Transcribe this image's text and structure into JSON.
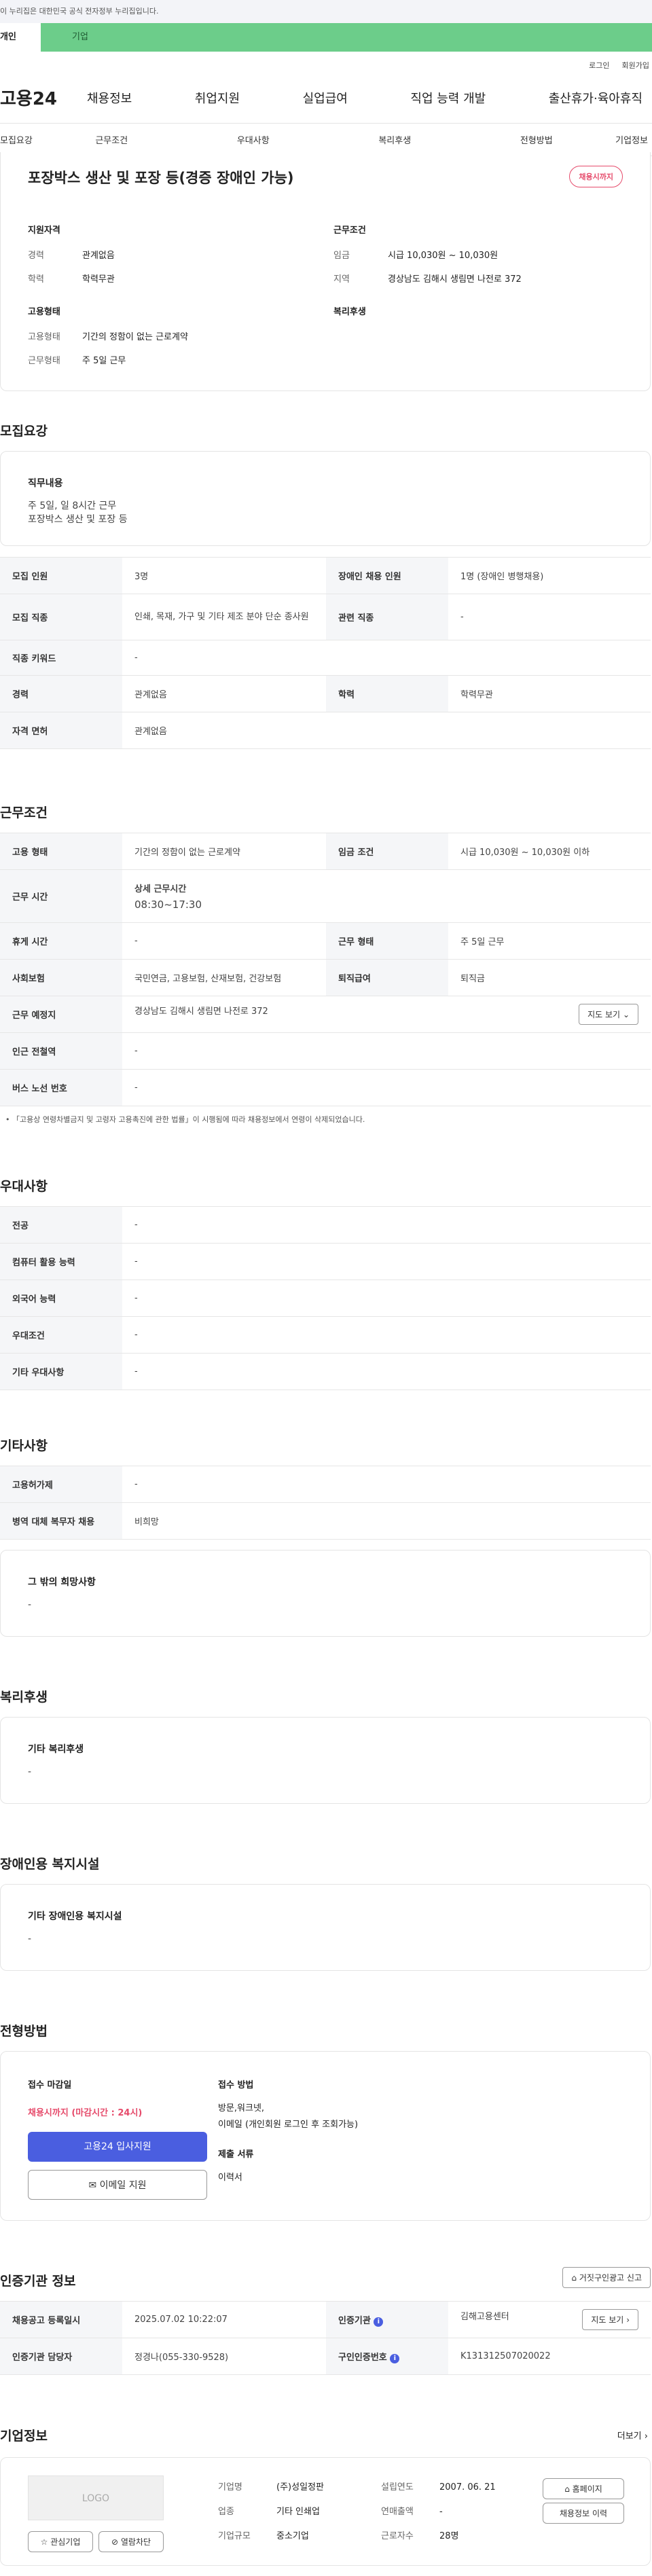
{
  "gov_banner": "이 누리집은 대한민국 공식 전자정부 누리집입니다.",
  "role_tabs": [
    "개인",
    "기업"
  ],
  "util": [
    "로그인",
    "회원가입"
  ],
  "logo": "고용24",
  "gnb": [
    "채용정보",
    "취업지원",
    "실업급여",
    "직업 능력 개발",
    "출산휴가·육아휴직"
  ],
  "subtabs": [
    "모집요강",
    "근무조건",
    "우대사항",
    "복리후생",
    "전형방법",
    "기업정보"
  ],
  "summary": {
    "title": "포장박스 생산 및 포장 등(경증 장애인 가능)",
    "badge": "채용시까지",
    "qual_title": "지원자격",
    "qual": [
      {
        "k": "경력",
        "v": "관계없음"
      },
      {
        "k": "학력",
        "v": "학력무관"
      }
    ],
    "cond_title": "근무조건",
    "cond": [
      {
        "k": "임금",
        "v": "시급 10,030원 ~ 10,030원"
      },
      {
        "k": "지역",
        "v": "경상남도 김해시 생림면 나전로 372"
      }
    ],
    "emp_title": "고용형태",
    "emp": [
      {
        "k": "고용형태",
        "v": "기간의 정함이 없는 근로계약"
      },
      {
        "k": "근무형태",
        "v": "주 5일 근무"
      }
    ],
    "welfare_title": "복리후생"
  },
  "recruit": {
    "title": "모집요강",
    "duty_label": "직무내용",
    "duty_text": [
      "주 5일, 일 8시간 근무",
      "포장박스 생산 및 포장 등"
    ],
    "rows": [
      [
        "모집 인원",
        "3명",
        "장애인 채용 인원",
        "1명 (장애인 병행채용)"
      ],
      [
        "모집 직종",
        "인쇄, 목재, 가구 및 기타 제조 분야 단순 종사원",
        "관련 직종",
        "-"
      ],
      [
        "직종 키워드",
        "-"
      ],
      [
        "경력",
        "관계없음",
        "학력",
        "학력무관"
      ],
      [
        "자격 면허",
        "관계없음"
      ]
    ]
  },
  "work": {
    "title": "근무조건",
    "employ_type": "고용 형태",
    "employ_type_v": "기간의 정함이 없는 근로계약",
    "wage": "임금 조건",
    "wage_v": "시급 10,030원 ~ 10,030원 이하",
    "hours": "근무 시간",
    "hours_label": "상세 근무시간",
    "hours_v": "08:30~17:30",
    "rest": "휴게 시간",
    "rest_v": "-",
    "form": "근무 형태",
    "form_v": "주 5일 근무",
    "ins": "사회보험",
    "ins_v": "국민연금, 고용보험, 산재보험, 건강보험",
    "sev": "퇴직급여",
    "sev_v": "퇴직금",
    "place": "근무 예정지",
    "place_v": "경상남도 김해시 생림면 나전로 372",
    "map": "지도 보기",
    "subway": "인근 전철역",
    "subway_v": "-",
    "bus": "버스 노선 번호",
    "bus_v": "-",
    "note": "「고용상 연령차별금지 및 고령자 고용촉진에 관한 법률」이 시행됨에 따라 채용정보에서 연령이 삭제되었습니다."
  },
  "pref": {
    "title": "우대사항",
    "rows": [
      [
        "전공",
        "-"
      ],
      [
        "컴퓨터 활용 능력",
        "-"
      ],
      [
        "외국어 능력",
        "-"
      ],
      [
        "우대조건",
        "-"
      ],
      [
        "기타 우대사항",
        "-"
      ]
    ]
  },
  "etc": {
    "title": "기타사항",
    "rows": [
      [
        "고용허가제",
        "-"
      ],
      [
        "병역 대체 복무자 채용",
        "비희망"
      ]
    ],
    "hope_label": "그 밖의 희망사항",
    "hope_v": "-"
  },
  "welfare": {
    "title": "복리후생",
    "label": "기타 복리후생",
    "v": "-"
  },
  "disab": {
    "title": "장애인용 복지시설",
    "label": "기타 장애인용 복지시설",
    "v": "-"
  },
  "process": {
    "title": "전형방법",
    "deadline_label": "접수 마감일",
    "deadline_v": "채용시까지 (마감시간 : 24시)",
    "apply_btn": "고용24 입사지원",
    "email_btn": "이메일 지원",
    "method_label": "접수 방법",
    "method_v": [
      "방문,워크넷,",
      "이메일 (개인회원 로그인 후 조회가능)"
    ],
    "docs_label": "제출 서류",
    "docs_v": "이력서"
  },
  "cert": {
    "title": "인증기관 정보",
    "report": "거짓구인광고 신고",
    "rows": [
      [
        "채용공고 등록일시",
        "2025.07.02 10:22:07",
        "인증기관",
        "김해고용센터"
      ],
      [
        "인증기관 담당자",
        "정경나(055-330-9528)",
        "구인인증번호",
        "K131312507020022"
      ]
    ],
    "map": "지도 보기"
  },
  "company": {
    "title": "기업정보",
    "more": "더보기",
    "logo": "LOGO",
    "fav": "관심기업",
    "block": "열람차단",
    "name_k": "기업명",
    "name_v": "(주)성일정판",
    "ind_k": "업종",
    "ind_v": "기타 인쇄업",
    "size_k": "기업규모",
    "size_v": "중소기업",
    "est_k": "설립연도",
    "est_v": "2007. 06. 21",
    "rev_k": "연매출액",
    "rev_v": "-",
    "emp_k": "근로자수",
    "emp_v": "28명",
    "home": "홈페이지",
    "info": "채용정보 이력"
  },
  "colors": {
    "green": "#6ccd8a",
    "pink": "#e64b6b",
    "blue": "#4a5ee0"
  }
}
